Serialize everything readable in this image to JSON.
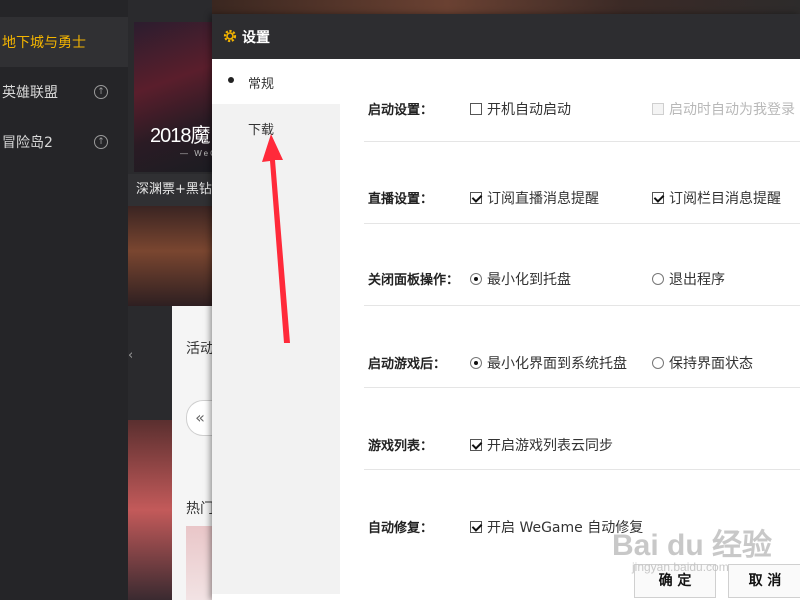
{
  "sidebar": {
    "games": [
      {
        "label": "地下城与勇士",
        "active": true
      },
      {
        "label": "英雄联盟",
        "active": false
      },
      {
        "label": "冒险岛2",
        "active": false
      }
    ]
  },
  "background": {
    "banner_text": "2018魔",
    "banner_sub": "— WeGa",
    "caption": "深渊票+黑钻",
    "activity_label": "活动",
    "hot_label": "热门",
    "prev_glyph": "«",
    "side_chevron": "‹"
  },
  "dialog": {
    "title": "设置",
    "nav": [
      {
        "label": "常规"
      },
      {
        "label": "下载"
      }
    ],
    "rows": [
      {
        "label": "启动设置：",
        "options": [
          {
            "type": "checkbox",
            "label": "开机自动启动",
            "checked": false,
            "disabled": false
          },
          {
            "type": "checkbox",
            "label": "启动时自动为我登录",
            "checked": false,
            "disabled": true
          }
        ]
      },
      {
        "label": "直播设置：",
        "options": [
          {
            "type": "checkbox",
            "label": "订阅直播消息提醒",
            "checked": true,
            "disabled": false
          },
          {
            "type": "checkbox",
            "label": "订阅栏目消息提醒",
            "checked": true,
            "disabled": false
          }
        ]
      },
      {
        "label": "关闭面板操作：",
        "options": [
          {
            "type": "radio",
            "label": "最小化到托盘",
            "checked": true,
            "disabled": false
          },
          {
            "type": "radio",
            "label": "退出程序",
            "checked": false,
            "disabled": false
          }
        ]
      },
      {
        "label": "启动游戏后：",
        "options": [
          {
            "type": "radio",
            "label": "最小化界面到系统托盘",
            "checked": true,
            "disabled": false
          },
          {
            "type": "radio",
            "label": "保持界面状态",
            "checked": false,
            "disabled": false
          }
        ]
      },
      {
        "label": "游戏列表：",
        "options": [
          {
            "type": "checkbox",
            "label": "开启游戏列表云同步",
            "checked": true,
            "disabled": false
          }
        ]
      },
      {
        "label": "自动修复：",
        "options": [
          {
            "type": "checkbox",
            "label": "开启 WeGame 自动修复",
            "checked": true,
            "disabled": false
          }
        ]
      }
    ],
    "ok_label": "确 定",
    "cancel_label": "取 消"
  },
  "watermark": {
    "main": "Bai du 经验",
    "sub": "jingyan.baidu.com"
  },
  "colors": {
    "accent_active_game": "#f3b400",
    "arrow": "#ff2a3a",
    "header_bg": "#2d2d30"
  },
  "icons": [
    "gear-icon",
    "upload-arrow-icon",
    "checkbox-icon",
    "radio-icon",
    "double-chevron-left-icon"
  ]
}
